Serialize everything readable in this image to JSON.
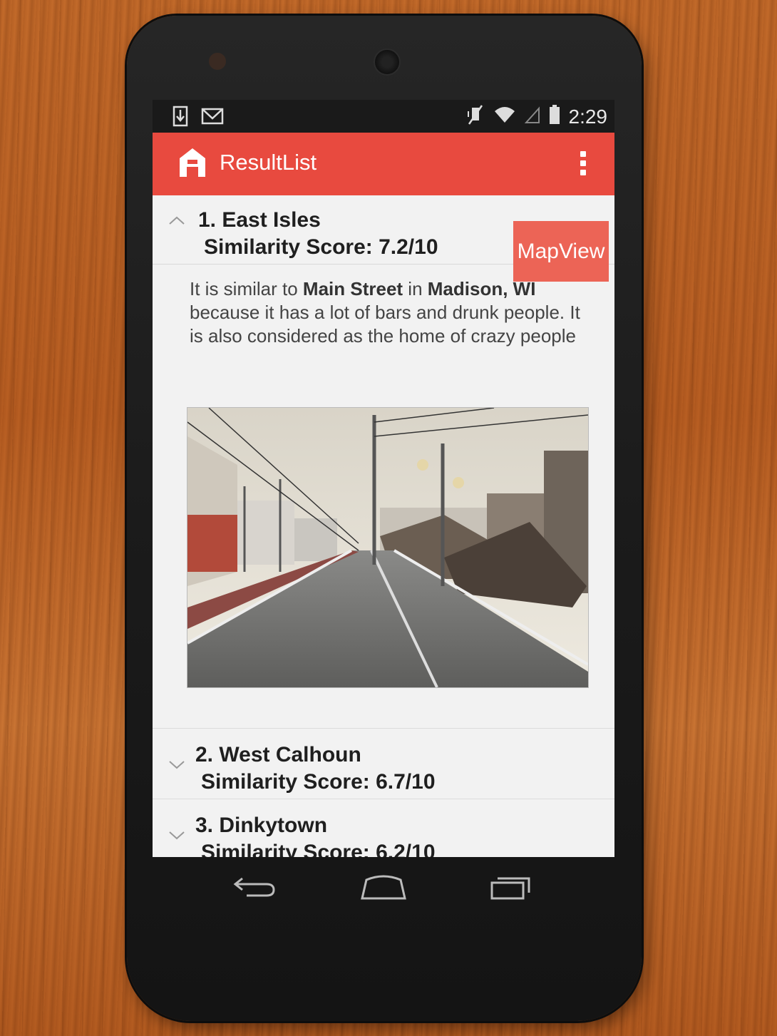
{
  "status_bar": {
    "time": "2:29",
    "left_icons": [
      "download-icon",
      "gmail-icon"
    ],
    "right_icons": [
      "vibrate-mute-icon",
      "wifi-icon",
      "signal-icon",
      "battery-icon"
    ]
  },
  "action_bar": {
    "app_icon": "house-icon",
    "title": "ResultList",
    "overflow_icon": "overflow-menu-icon"
  },
  "results": [
    {
      "title": "1. East Isles",
      "score": "Similarity Score: 7.2/10",
      "expanded": true,
      "map_button": "MapView",
      "description": {
        "t1": "It is similar to ",
        "street": "Main Street",
        "t2": " in ",
        "city": "Madison, WI",
        "t3": " because it has a lot of bars and drunk people. It is also considered as the home of crazy people"
      },
      "image": "street-photo"
    },
    {
      "title": "2. West Calhoun",
      "score": "Similarity Score: 6.7/10",
      "expanded": false
    },
    {
      "title": "3. Dinkytown",
      "score": "Similarity Score: 6.2/10",
      "expanded": false
    }
  ],
  "nav_bar": {
    "back": "back-icon",
    "home": "home-icon",
    "recents": "recents-icon"
  }
}
